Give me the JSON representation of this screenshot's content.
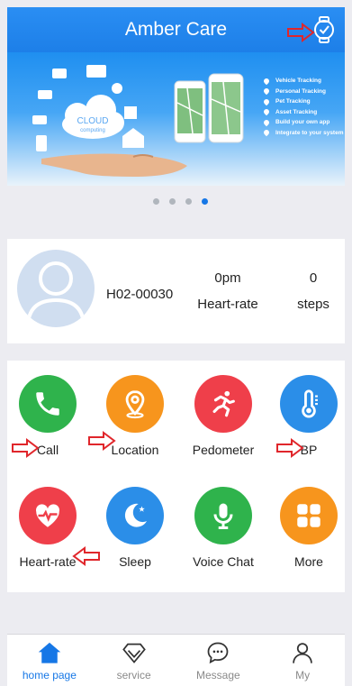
{
  "header": {
    "title": "Amber Care",
    "watch_icon": "watch-icon"
  },
  "banner": {
    "cloud_title": "CLOUD",
    "cloud_subtitle": "computing",
    "features": [
      "Vehicle Tracking",
      "Personal Tracking",
      "Pet Tracking",
      "Asset Tracking",
      "Build your own app",
      "Integrate to your system"
    ]
  },
  "carousel": {
    "count": 4,
    "active_index": 3
  },
  "profile": {
    "device_id": "H02-00030",
    "heart_value": "0pm",
    "heart_label": "Heart-rate",
    "steps_value": "0",
    "steps_label": "steps"
  },
  "apps": [
    {
      "label": "Call",
      "icon": "phone-icon",
      "color": "#2fb34c"
    },
    {
      "label": "Location",
      "icon": "location-pin-icon",
      "color": "#f7951d"
    },
    {
      "label": "Pedometer",
      "icon": "running-icon",
      "color": "#ef3f4a"
    },
    {
      "label": "BP",
      "icon": "thermometer-icon",
      "color": "#2b8ee8"
    },
    {
      "label": "Heart-rate",
      "icon": "heart-rate-icon",
      "color": "#ef3f4a"
    },
    {
      "label": "Sleep",
      "icon": "moon-icon",
      "color": "#2b8ee8"
    },
    {
      "label": "Voice Chat",
      "icon": "microphone-icon",
      "color": "#2fb34c"
    },
    {
      "label": "More",
      "icon": "grid-icon",
      "color": "#f7951d"
    }
  ],
  "tabs": [
    {
      "label": "home page",
      "icon": "home-icon"
    },
    {
      "label": "service",
      "icon": "diamond-icon"
    },
    {
      "label": "Message",
      "icon": "chat-icon"
    },
    {
      "label": "My",
      "icon": "user-icon"
    }
  ],
  "colors": {
    "primary": "#1d7fe8",
    "annotation": "#e0262b"
  }
}
